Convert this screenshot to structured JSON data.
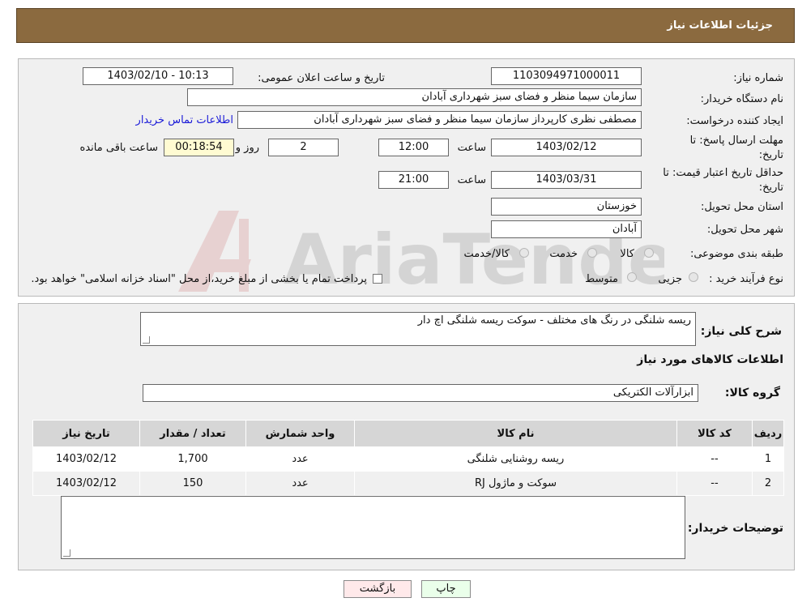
{
  "header": {
    "title": "جزئیات اطلاعات نیاز"
  },
  "info": {
    "need_number_label": "شماره نیاز:",
    "need_number": "1103094971000011",
    "announce_label": "تاریخ و ساعت اعلان عمومی:",
    "announce_value": "1403/02/10 - 10:13",
    "buyer_org_label": "نام دستگاه خریدار:",
    "buyer_org": "سازمان سیما منظر و فضای سبز شهرداری آبادان",
    "requester_label": "ایجاد کننده درخواست:",
    "requester": "مصطفی نظری کارپرداز سازمان سیما منظر و فضای سبز شهرداری آبادان",
    "contact_link": "اطلاعات تماس خریدار",
    "deadline_label_1": "مهلت ارسال پاسخ: تا",
    "deadline_label_2": "تاریخ:",
    "deadline_date": "1403/02/12",
    "time_label": "ساعت",
    "deadline_time": "12:00",
    "days": "2",
    "days_label": "روز و",
    "remaining": "00:18:54",
    "remaining_label": "ساعت باقی مانده",
    "validity_label_1": "حداقل تاریخ اعتبار قیمت: تا",
    "validity_label_2": "تاریخ:",
    "validity_date": "1403/03/31",
    "validity_time": "21:00",
    "province_label": "استان محل تحویل:",
    "province": "خوزستان",
    "city_label": "شهر محل تحویل:",
    "city": "آبادان",
    "category_label": "طبقه بندی موضوعی:",
    "category_options": [
      "کالا",
      "خدمت",
      "کالا/خدمت"
    ],
    "process_label": "نوع فرآیند خرید :",
    "process_options": [
      "جزیی",
      "متوسط"
    ],
    "process_note": "پرداخت تمام یا بخشی از مبلغ خرید،از محل \"اسناد خزانه اسلامی\" خواهد بود."
  },
  "details": {
    "description_label": "شرح کلی نیاز:",
    "description": "ریسه شلنگی در رنگ های مختلف  - سوکت ریسه شلنگی اچ دار",
    "goods_title": "اطلاعات کالاهای مورد نیاز",
    "group_label": "گروه کالا:",
    "group_value": "ابزارآلات الکتریکی",
    "table": {
      "headers": [
        "ردیف",
        "کد کالا",
        "نام کالا",
        "واحد شمارش",
        "تعداد / مقدار",
        "تاریخ نیاز"
      ],
      "rows": [
        [
          "1",
          "--",
          "ریسه روشنایی شلنگی",
          "عدد",
          "1,700",
          "1403/02/12"
        ],
        [
          "2",
          "--",
          "سوکت و ماژول RJ",
          "عدد",
          "150",
          "1403/02/12"
        ]
      ]
    },
    "buyer_notes_label": "توضیحات خریدار:",
    "buyer_notes": ""
  },
  "buttons": {
    "print": "چاپ",
    "back": "بازگشت"
  },
  "watermark": {
    "text": "AriaTender.neT"
  },
  "colors": {
    "header_bg": "#8b6a3f",
    "timer_bg": "#fffbd2",
    "print_bg": "#eaffea",
    "back_bg": "#ffe9ea",
    "link": "#1a1ad8"
  }
}
